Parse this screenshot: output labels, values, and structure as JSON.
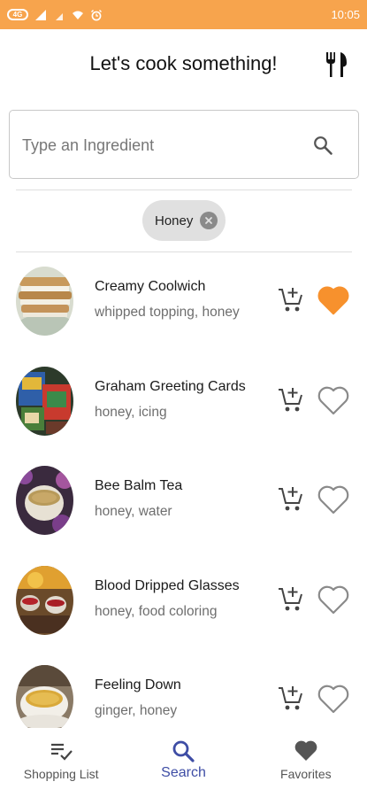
{
  "status_bar": {
    "time": "10:05",
    "network_badge": "4G",
    "background": "#f7a44d"
  },
  "header": {
    "title": "Let's cook something!",
    "icon": "cutlery-icon"
  },
  "search": {
    "placeholder": "Type an Ingredient",
    "value": "",
    "icon": "search-icon"
  },
  "filters": {
    "chips": [
      {
        "label": "Honey",
        "icon": "close-icon"
      }
    ]
  },
  "recipes": [
    {
      "name": "Creamy Coolwich",
      "ingredients": "whipped topping, honey",
      "favorite": true
    },
    {
      "name": "Graham Greeting Cards",
      "ingredients": "honey, icing",
      "favorite": false
    },
    {
      "name": "Bee Balm Tea",
      "ingredients": "honey, water",
      "favorite": false
    },
    {
      "name": "Blood Dripped Glasses",
      "ingredients": "honey, food coloring",
      "favorite": false
    },
    {
      "name": "Feeling Down",
      "ingredients": "ginger, honey",
      "favorite": false
    }
  ],
  "bottom_nav": {
    "items": [
      {
        "label": "Shopping List",
        "icon": "shopping-list-icon",
        "active": false
      },
      {
        "label": "Search",
        "icon": "search-icon",
        "active": true
      },
      {
        "label": "Favorites",
        "icon": "heart-icon",
        "active": false
      }
    ]
  },
  "colors": {
    "accent": "#f7a44d",
    "favorite": "#f7912d",
    "nav_active": "#3e4da5",
    "icon_gray": "#8a8a8a"
  }
}
